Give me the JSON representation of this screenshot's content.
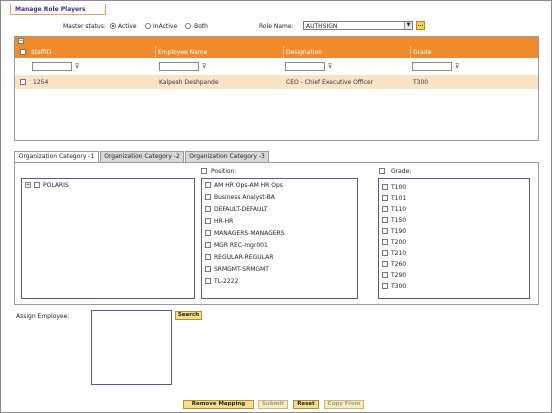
{
  "page": {
    "title": "Manage Role Players"
  },
  "filters": {
    "master_status_label": "Master status:",
    "status_options": [
      "Active",
      "InActive",
      "Both"
    ],
    "selected_status": "Active",
    "role_name_label": "Role Name:",
    "role_name_value": "AUTHSIGN",
    "lookup_button": "..."
  },
  "grid": {
    "columns": [
      "StaffID",
      "Employee Name",
      "Designation",
      "Grade"
    ],
    "filter_icon": "filter-icon",
    "rows": [
      {
        "staff_id": "1254",
        "employee_name": "Kalpesh Deshpande",
        "designation": "CEO - Chief Executive Officer",
        "grade": "T300"
      }
    ]
  },
  "tabs": [
    "Organization Category -1",
    "Organization Category -2",
    "Organization Category -3"
  ],
  "org_tree": {
    "items": [
      "POLARIS"
    ]
  },
  "position": {
    "label": "Position:",
    "items": [
      "AM HR Ops-AM HR Ops",
      "Business Analyst-BA",
      "DEFAULT-DEFAULT",
      "HR-HR",
      "MANAGERS-MANAGERS",
      "MGR REC-mgr001",
      "REGULAR-REGULAR",
      "SRMGMT-SRMGMT",
      "TL-2222"
    ]
  },
  "grade": {
    "label": "Grade:",
    "items": [
      "T100",
      "T101",
      "T110",
      "T150",
      "T190",
      "T200",
      "T210",
      "T260",
      "T290",
      "T300"
    ]
  },
  "assign": {
    "label": "Assign Employee:",
    "search_button": "Search"
  },
  "actions": {
    "remove_mapping": "Remove Mapping",
    "submit": "Submit",
    "reset": "Reset",
    "copy_from": "Copy From"
  },
  "colors": {
    "header_orange": "#ef8b2c",
    "row_highlight": "#fbe3c7",
    "button_yellow": "#f5dd8a",
    "title_purple": "#4a2a86"
  }
}
